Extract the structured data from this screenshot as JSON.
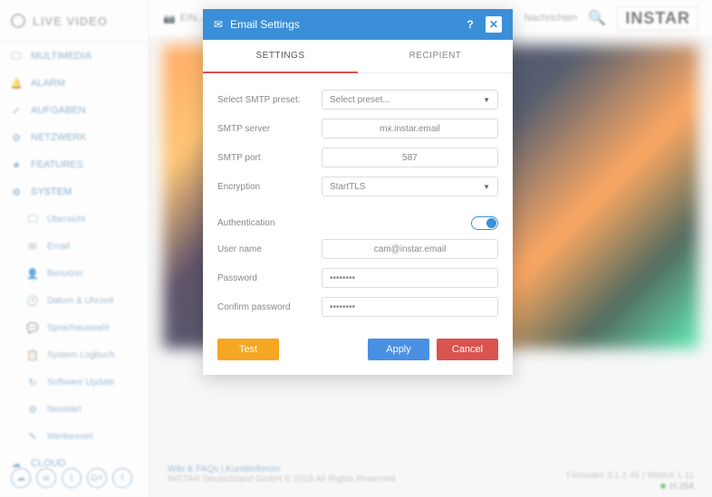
{
  "brand": {
    "live": "LIVE VIDEO",
    "logo": "INSTAR"
  },
  "sidebar": {
    "items": [
      {
        "icon": "🖵",
        "label": "MULTIMEDIA"
      },
      {
        "icon": "🔔",
        "label": "ALARM"
      },
      {
        "icon": "✓",
        "label": "AUFGABEN"
      },
      {
        "icon": "⚙",
        "label": "NETZWERK"
      },
      {
        "icon": "★",
        "label": "FEATURES"
      },
      {
        "icon": "⚙",
        "label": "SYSTEM"
      }
    ],
    "subs": [
      {
        "icon": "🖵",
        "label": "Übersicht"
      },
      {
        "icon": "✉",
        "label": "Email"
      },
      {
        "icon": "👤",
        "label": "Benutzer"
      },
      {
        "icon": "🕐",
        "label": "Datum & Uhrzeit"
      },
      {
        "icon": "💬",
        "label": "Sprachauswahl"
      },
      {
        "icon": "📋",
        "label": "System Logbuch"
      },
      {
        "icon": "↻",
        "label": "Software Update"
      },
      {
        "icon": "⚙",
        "label": "Neustart"
      },
      {
        "icon": "✎",
        "label": "Werksreset"
      }
    ],
    "cloud": {
      "icon": "☁",
      "label": "CLOUD"
    }
  },
  "topbar": {
    "item1": "EIN…",
    "item2": "Nachrichten"
  },
  "modal": {
    "title": "Email Settings",
    "tabs": {
      "settings": "SETTINGS",
      "recipient": "RECIPIENT"
    },
    "labels": {
      "preset": "Select SMTP preset:",
      "server": "SMTP server",
      "port": "SMTP port",
      "encryption": "Encryption",
      "auth": "Authentication",
      "user": "User name",
      "password": "Password",
      "confirm": "Confirm password"
    },
    "values": {
      "preset": "Select preset...",
      "server": "mx.instar.email",
      "port": "587",
      "encryption": "StartTLS",
      "user": "cam@instar.email",
      "password": "••••••••",
      "confirm": "••••••••"
    },
    "buttons": {
      "test": "Test",
      "apply": "Apply",
      "cancel": "Cancel"
    }
  },
  "footer": {
    "links": "Wiki & FAQs | Kundenforum",
    "copy": "INSTAR Deutschland GmbH © 2016 All Rights Reserved",
    "firmware": "Firmware 3.1.2.45 | WebUI 1.11",
    "codec": "H.264"
  }
}
